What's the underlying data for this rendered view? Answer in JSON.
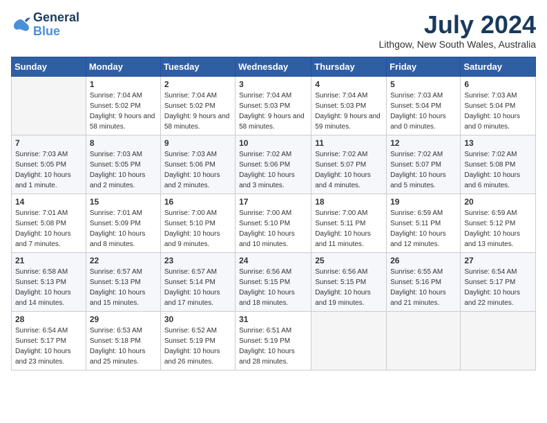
{
  "logo": {
    "line1": "General",
    "line2": "Blue"
  },
  "title": "July 2024",
  "location": "Lithgow, New South Wales, Australia",
  "days_of_week": [
    "Sunday",
    "Monday",
    "Tuesday",
    "Wednesday",
    "Thursday",
    "Friday",
    "Saturday"
  ],
  "weeks": [
    [
      {
        "num": "",
        "sunrise": "",
        "sunset": "",
        "daylight": ""
      },
      {
        "num": "1",
        "sunrise": "Sunrise: 7:04 AM",
        "sunset": "Sunset: 5:02 PM",
        "daylight": "Daylight: 9 hours and 58 minutes."
      },
      {
        "num": "2",
        "sunrise": "Sunrise: 7:04 AM",
        "sunset": "Sunset: 5:02 PM",
        "daylight": "Daylight: 9 hours and 58 minutes."
      },
      {
        "num": "3",
        "sunrise": "Sunrise: 7:04 AM",
        "sunset": "Sunset: 5:03 PM",
        "daylight": "Daylight: 9 hours and 58 minutes."
      },
      {
        "num": "4",
        "sunrise": "Sunrise: 7:04 AM",
        "sunset": "Sunset: 5:03 PM",
        "daylight": "Daylight: 9 hours and 59 minutes."
      },
      {
        "num": "5",
        "sunrise": "Sunrise: 7:03 AM",
        "sunset": "Sunset: 5:04 PM",
        "daylight": "Daylight: 10 hours and 0 minutes."
      },
      {
        "num": "6",
        "sunrise": "Sunrise: 7:03 AM",
        "sunset": "Sunset: 5:04 PM",
        "daylight": "Daylight: 10 hours and 0 minutes."
      }
    ],
    [
      {
        "num": "7",
        "sunrise": "Sunrise: 7:03 AM",
        "sunset": "Sunset: 5:05 PM",
        "daylight": "Daylight: 10 hours and 1 minute."
      },
      {
        "num": "8",
        "sunrise": "Sunrise: 7:03 AM",
        "sunset": "Sunset: 5:05 PM",
        "daylight": "Daylight: 10 hours and 2 minutes."
      },
      {
        "num": "9",
        "sunrise": "Sunrise: 7:03 AM",
        "sunset": "Sunset: 5:06 PM",
        "daylight": "Daylight: 10 hours and 2 minutes."
      },
      {
        "num": "10",
        "sunrise": "Sunrise: 7:02 AM",
        "sunset": "Sunset: 5:06 PM",
        "daylight": "Daylight: 10 hours and 3 minutes."
      },
      {
        "num": "11",
        "sunrise": "Sunrise: 7:02 AM",
        "sunset": "Sunset: 5:07 PM",
        "daylight": "Daylight: 10 hours and 4 minutes."
      },
      {
        "num": "12",
        "sunrise": "Sunrise: 7:02 AM",
        "sunset": "Sunset: 5:07 PM",
        "daylight": "Daylight: 10 hours and 5 minutes."
      },
      {
        "num": "13",
        "sunrise": "Sunrise: 7:02 AM",
        "sunset": "Sunset: 5:08 PM",
        "daylight": "Daylight: 10 hours and 6 minutes."
      }
    ],
    [
      {
        "num": "14",
        "sunrise": "Sunrise: 7:01 AM",
        "sunset": "Sunset: 5:08 PM",
        "daylight": "Daylight: 10 hours and 7 minutes."
      },
      {
        "num": "15",
        "sunrise": "Sunrise: 7:01 AM",
        "sunset": "Sunset: 5:09 PM",
        "daylight": "Daylight: 10 hours and 8 minutes."
      },
      {
        "num": "16",
        "sunrise": "Sunrise: 7:00 AM",
        "sunset": "Sunset: 5:10 PM",
        "daylight": "Daylight: 10 hours and 9 minutes."
      },
      {
        "num": "17",
        "sunrise": "Sunrise: 7:00 AM",
        "sunset": "Sunset: 5:10 PM",
        "daylight": "Daylight: 10 hours and 10 minutes."
      },
      {
        "num": "18",
        "sunrise": "Sunrise: 7:00 AM",
        "sunset": "Sunset: 5:11 PM",
        "daylight": "Daylight: 10 hours and 11 minutes."
      },
      {
        "num": "19",
        "sunrise": "Sunrise: 6:59 AM",
        "sunset": "Sunset: 5:11 PM",
        "daylight": "Daylight: 10 hours and 12 minutes."
      },
      {
        "num": "20",
        "sunrise": "Sunrise: 6:59 AM",
        "sunset": "Sunset: 5:12 PM",
        "daylight": "Daylight: 10 hours and 13 minutes."
      }
    ],
    [
      {
        "num": "21",
        "sunrise": "Sunrise: 6:58 AM",
        "sunset": "Sunset: 5:13 PM",
        "daylight": "Daylight: 10 hours and 14 minutes."
      },
      {
        "num": "22",
        "sunrise": "Sunrise: 6:57 AM",
        "sunset": "Sunset: 5:13 PM",
        "daylight": "Daylight: 10 hours and 15 minutes."
      },
      {
        "num": "23",
        "sunrise": "Sunrise: 6:57 AM",
        "sunset": "Sunset: 5:14 PM",
        "daylight": "Daylight: 10 hours and 17 minutes."
      },
      {
        "num": "24",
        "sunrise": "Sunrise: 6:56 AM",
        "sunset": "Sunset: 5:15 PM",
        "daylight": "Daylight: 10 hours and 18 minutes."
      },
      {
        "num": "25",
        "sunrise": "Sunrise: 6:56 AM",
        "sunset": "Sunset: 5:15 PM",
        "daylight": "Daylight: 10 hours and 19 minutes."
      },
      {
        "num": "26",
        "sunrise": "Sunrise: 6:55 AM",
        "sunset": "Sunset: 5:16 PM",
        "daylight": "Daylight: 10 hours and 21 minutes."
      },
      {
        "num": "27",
        "sunrise": "Sunrise: 6:54 AM",
        "sunset": "Sunset: 5:17 PM",
        "daylight": "Daylight: 10 hours and 22 minutes."
      }
    ],
    [
      {
        "num": "28",
        "sunrise": "Sunrise: 6:54 AM",
        "sunset": "Sunset: 5:17 PM",
        "daylight": "Daylight: 10 hours and 23 minutes."
      },
      {
        "num": "29",
        "sunrise": "Sunrise: 6:53 AM",
        "sunset": "Sunset: 5:18 PM",
        "daylight": "Daylight: 10 hours and 25 minutes."
      },
      {
        "num": "30",
        "sunrise": "Sunrise: 6:52 AM",
        "sunset": "Sunset: 5:19 PM",
        "daylight": "Daylight: 10 hours and 26 minutes."
      },
      {
        "num": "31",
        "sunrise": "Sunrise: 6:51 AM",
        "sunset": "Sunset: 5:19 PM",
        "daylight": "Daylight: 10 hours and 28 minutes."
      },
      {
        "num": "",
        "sunrise": "",
        "sunset": "",
        "daylight": ""
      },
      {
        "num": "",
        "sunrise": "",
        "sunset": "",
        "daylight": ""
      },
      {
        "num": "",
        "sunrise": "",
        "sunset": "",
        "daylight": ""
      }
    ]
  ]
}
